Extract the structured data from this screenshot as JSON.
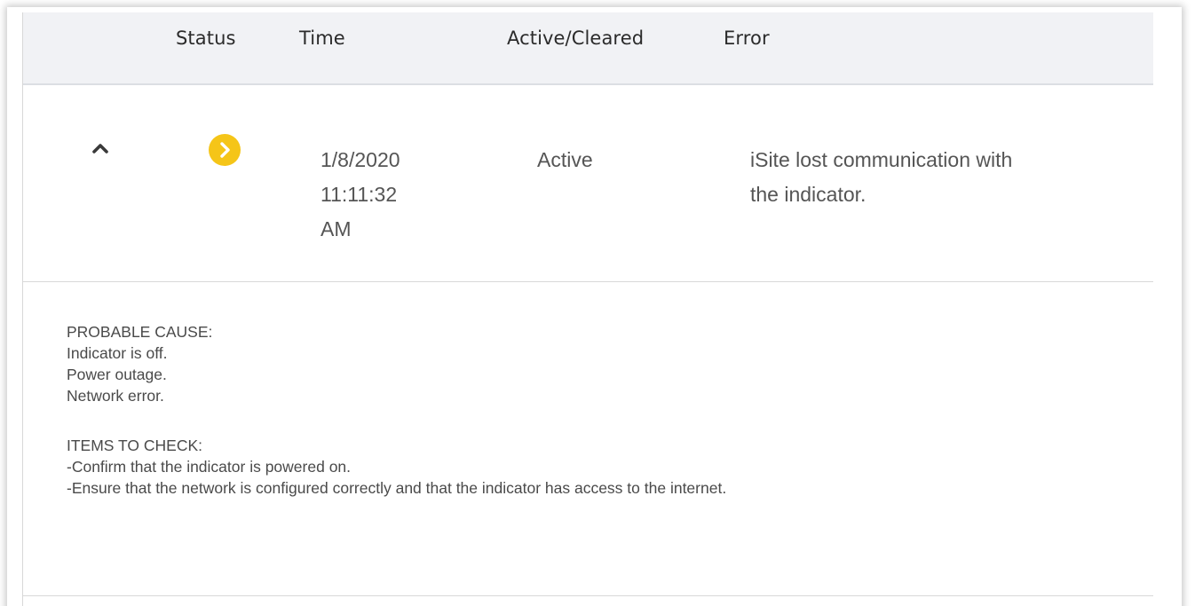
{
  "table": {
    "headers": {
      "status": "Status",
      "time": "Time",
      "active_cleared": "Active/Cleared",
      "error": "Error"
    },
    "rows": [
      {
        "expanded": true,
        "status_icon": "chevron-right-circle-icon",
        "status_color": "#f5c518",
        "time_date": "1/8/2020",
        "time_clock": "11:11:32",
        "time_ampm": "AM",
        "active_cleared": "Active",
        "error_line1": "iSite lost communication with",
        "error_line2": "the indicator."
      }
    ]
  },
  "details": {
    "cause_heading": "PROBABLE CAUSE:",
    "causes": [
      "Indicator is off.",
      "Power outage.",
      "Network error."
    ],
    "check_heading": "ITEMS TO CHECK:",
    "checks": [
      "-Confirm that the indicator is powered on.",
      "-Ensure that the network is configured correctly and that the indicator has access to the internet."
    ]
  }
}
